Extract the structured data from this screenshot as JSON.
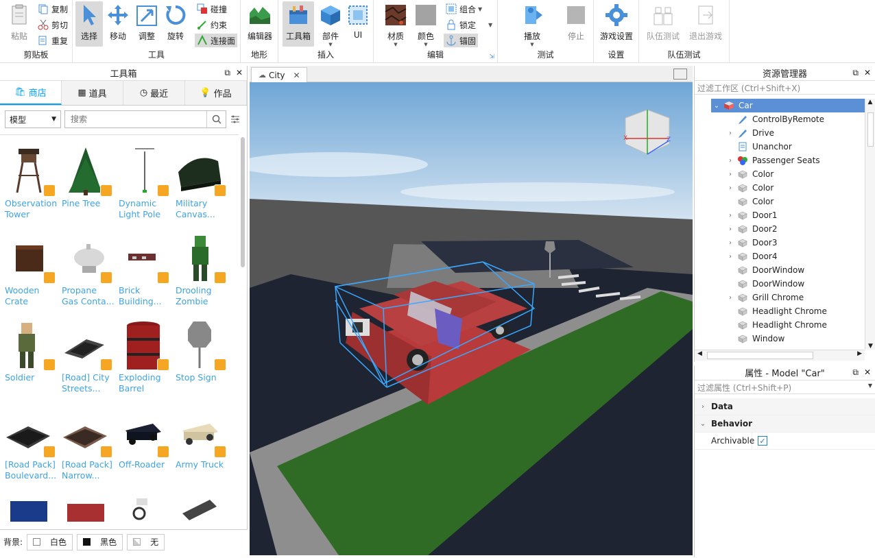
{
  "ribbon": {
    "clipboard": {
      "label": "剪贴板",
      "paste": "粘贴",
      "copy": "复制",
      "cut": "剪切",
      "duplicate": "重复"
    },
    "tools": {
      "label": "工具",
      "select": "选择",
      "move": "移动",
      "scale": "调整",
      "rotate": "旋转",
      "collisions": "碰撞",
      "constraints": "约束",
      "join_surfaces": "连接面"
    },
    "terrain": {
      "label": "地形",
      "editor": "编辑器"
    },
    "insert": {
      "label": "插入",
      "toolbox": "工具箱",
      "part": "部件",
      "ui": "UI"
    },
    "edit": {
      "label": "编辑",
      "material": "材质",
      "color": "颜色",
      "group": "组合",
      "lock": "锁定",
      "anchor": "锚固"
    },
    "test": {
      "label": "测试",
      "play": "播放",
      "stop": "停止"
    },
    "settings": {
      "label": "设置",
      "game_settings": "游戏设置"
    },
    "team_test": {
      "label": "队伍测试",
      "team_test": "队伍测试",
      "exit_game": "退出游戏"
    }
  },
  "toolbox": {
    "title": "工具箱",
    "tabs": [
      {
        "label": "商店",
        "icon": "bag-icon"
      },
      {
        "label": "道具",
        "icon": "grid-icon"
      },
      {
        "label": "最近",
        "icon": "clock-icon"
      },
      {
        "label": "作品",
        "icon": "bulb-icon"
      }
    ],
    "category": "模型",
    "search_placeholder": "搜索",
    "items": [
      {
        "l1": "Observation",
        "l2": "Tower"
      },
      {
        "l1": "Pine Tree",
        "l2": ""
      },
      {
        "l1": "Dynamic",
        "l2": "Light Pole"
      },
      {
        "l1": "Military",
        "l2": "Canvas..."
      },
      {
        "l1": "Wooden",
        "l2": "Crate"
      },
      {
        "l1": "Propane",
        "l2": "Gas Conta..."
      },
      {
        "l1": "Brick",
        "l2": "Building..."
      },
      {
        "l1": "Drooling",
        "l2": "Zombie"
      },
      {
        "l1": "Soldier",
        "l2": ""
      },
      {
        "l1": "[Road] City",
        "l2": "Streets..."
      },
      {
        "l1": "Exploding",
        "l2": "Barrel"
      },
      {
        "l1": "Stop Sign",
        "l2": ""
      },
      {
        "l1": "[Road Pack]",
        "l2": "Boulevard..."
      },
      {
        "l1": "[Road Pack]",
        "l2": "Narrow..."
      },
      {
        "l1": "Off-Roader",
        "l2": ""
      },
      {
        "l1": "Army Truck",
        "l2": ""
      }
    ],
    "background_label": "背景:",
    "bg_white": "白色",
    "bg_black": "黑色",
    "bg_none": "无"
  },
  "viewport": {
    "tab": "City"
  },
  "explorer": {
    "title": "资源管理器",
    "filter_placeholder": "过滤工作区 (Ctrl+Shift+X)",
    "root": "Car",
    "children": [
      {
        "name": "ControlByRemote",
        "expandable": false
      },
      {
        "name": "Drive",
        "expandable": true
      },
      {
        "name": "Unanchor",
        "expandable": false
      },
      {
        "name": "Passenger Seats",
        "expandable": true
      },
      {
        "name": "Color",
        "expandable": true
      },
      {
        "name": "Color",
        "expandable": true
      },
      {
        "name": "Color",
        "expandable": false
      },
      {
        "name": "Door1",
        "expandable": true
      },
      {
        "name": "Door2",
        "expandable": true
      },
      {
        "name": "Door3",
        "expandable": true
      },
      {
        "name": "Door4",
        "expandable": true
      },
      {
        "name": "DoorWindow",
        "expandable": false
      },
      {
        "name": "DoorWindow",
        "expandable": false
      },
      {
        "name": "Grill Chrome",
        "expandable": true
      },
      {
        "name": "Headlight Chrome",
        "expandable": false
      },
      {
        "name": "Headlight Chrome",
        "expandable": false
      },
      {
        "name": "Window",
        "expandable": false
      }
    ]
  },
  "properties": {
    "title": "属性 - Model \"Car\"",
    "filter_placeholder": "过滤属性 (Ctrl+Shift+P)",
    "sections": [
      {
        "name": "Data",
        "expanded": false
      },
      {
        "name": "Behavior",
        "expanded": true
      }
    ],
    "archivable_label": "Archivable",
    "archivable": true
  },
  "colors": {
    "accent": "#00a2ff",
    "selected_row": "#5b8fd6",
    "item_text": "#3da3e8"
  }
}
